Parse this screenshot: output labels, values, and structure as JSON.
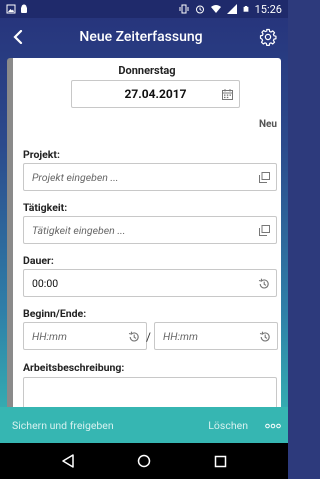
{
  "status_bar": {
    "time": "15:26"
  },
  "toolbar": {
    "title": "Neue Zeiterfassung"
  },
  "form": {
    "weekday": "Donnerstag",
    "date": "27.04.2017",
    "status": "Neu",
    "project_label": "Projekt:",
    "project_placeholder": "Projekt eingeben ...",
    "activity_label": "Tätigkeit:",
    "activity_placeholder": "Tätigkeit eingeben ...",
    "duration_label": "Dauer:",
    "duration_value": "00:00",
    "begin_end_label": "Beginn/Ende:",
    "begin_placeholder": "HH:mm",
    "separator": "/",
    "end_placeholder": "HH:mm",
    "description_label": "Arbeitsbeschreibung:"
  },
  "bottom_bar": {
    "save_label": "Sichern und freigeben",
    "delete_label": "Löschen",
    "more_label": "ooo"
  }
}
